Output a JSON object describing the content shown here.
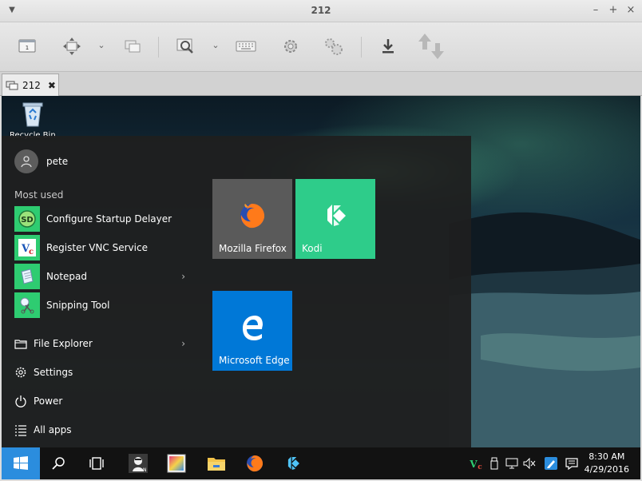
{
  "window": {
    "title": "212",
    "tab_label": "212",
    "tab_close": "✖"
  },
  "toolbar": {
    "items": [
      "display-icon",
      "fit-window-icon",
      "chevron-down-icon",
      "windows-icon",
      "zoom-icon",
      "chevron-down-icon",
      "keyboard-icon",
      "gear-icon",
      "gears-icon",
      "download-icon",
      "transfer-icon"
    ]
  },
  "desktop": {
    "recycle_bin_label": "Recycle Bin"
  },
  "start_menu": {
    "user_name": "pete",
    "most_used_label": "Most used",
    "apps": [
      {
        "label": "Configure Startup Delayer",
        "icon": "startup-delayer-icon",
        "color": "#2ecc71"
      },
      {
        "label": "Register VNC Service",
        "icon": "vnc-icon",
        "color": "#ffffff"
      },
      {
        "label": "Notepad",
        "icon": "notepad-icon",
        "color": "#2ecc71"
      },
      {
        "label": "Snipping Tool",
        "icon": "scissors-icon",
        "color": "#2ecc71"
      }
    ],
    "system": [
      {
        "label": "File Explorer",
        "icon": "folder-icon"
      },
      {
        "label": "Settings",
        "icon": "gear-icon"
      },
      {
        "label": "Power",
        "icon": "power-icon"
      },
      {
        "label": "All apps",
        "icon": "list-icon"
      }
    ],
    "tiles": [
      {
        "label": "Mozilla Firefox",
        "color": "#5a5a5a",
        "icon": "firefox-icon"
      },
      {
        "label": "Kodi",
        "color": "#2ecc8a",
        "icon": "kodi-icon"
      },
      {
        "label": "Microsoft Edge",
        "color": "#0078d7",
        "icon": "edge-icon"
      }
    ]
  },
  "taskbar": {
    "clock_time": "8:30 AM",
    "clock_date": "4/29/2016",
    "pinned": [
      "search-icon",
      "task-view-icon",
      "user-app-icon",
      "paint-icon",
      "folder-icon",
      "firefox-icon",
      "kodi-icon"
    ],
    "tray": [
      "vnc-icon",
      "usb-icon",
      "network-icon",
      "volume-mute-icon",
      "pen-icon",
      "notifications-icon"
    ]
  }
}
